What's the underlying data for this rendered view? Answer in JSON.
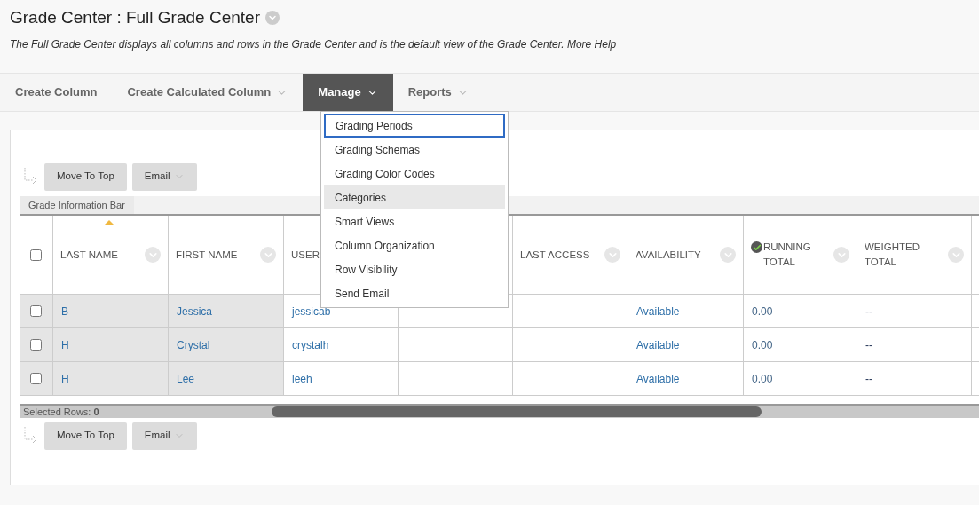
{
  "page": {
    "title": "Grade Center : Full Grade Center",
    "description": "The Full Grade Center displays all columns and rows in the Grade Center and is the default view of the Grade Center.",
    "help_link": "More Help"
  },
  "tabs": [
    {
      "label": "Create Column",
      "has_menu": false,
      "selected": false
    },
    {
      "label": "Create Calculated Column",
      "has_menu": true,
      "selected": false
    },
    {
      "label": "Manage",
      "has_menu": true,
      "selected": true
    },
    {
      "label": "Reports",
      "has_menu": true,
      "selected": false
    }
  ],
  "manage_menu": [
    {
      "label": "Grading Periods",
      "focused": true,
      "highlighted": false
    },
    {
      "label": "Grading Schemas",
      "focused": false,
      "highlighted": false
    },
    {
      "label": "Grading Color Codes",
      "focused": false,
      "highlighted": false
    },
    {
      "label": "Categories",
      "focused": false,
      "highlighted": true
    },
    {
      "label": "Smart Views",
      "focused": false,
      "highlighted": false
    },
    {
      "label": "Column Organization",
      "focused": false,
      "highlighted": false
    },
    {
      "label": "Row Visibility",
      "focused": false,
      "highlighted": false
    },
    {
      "label": "Send Email",
      "focused": false,
      "highlighted": false
    }
  ],
  "top_action_bar": {
    "buttons": [
      {
        "label": "Move To Top",
        "has_menu": false
      },
      {
        "label": "Email",
        "has_menu": true
      }
    ]
  },
  "info_bar": "Grade Information Bar",
  "table": {
    "select_all": {
      "checked": false
    },
    "columns": [
      {
        "label": "LAST NAME",
        "sorted": true,
        "graded": false
      },
      {
        "label": "FIRST NAME",
        "sorted": false,
        "graded": false
      },
      {
        "label": "USER"
      },
      {},
      {
        "label": "LAST ACCESS",
        "sorted": false,
        "graded": false
      },
      {
        "label": "AVAILABILITY",
        "sorted": false,
        "graded": false
      },
      {
        "label": "RUNNING TOTAL",
        "sorted": false,
        "graded": true
      },
      {
        "label": "WEIGHTED TOTAL",
        "sorted": false,
        "graded": false
      }
    ],
    "rows": [
      {
        "checked": false,
        "cells": [
          "B",
          "Jessica",
          "jessicab",
          "",
          "",
          "Available",
          "0.00",
          "--"
        ]
      },
      {
        "checked": false,
        "cells": [
          "H",
          "Crystal",
          "crystalh",
          "",
          "",
          "Available",
          "0.00",
          "--"
        ]
      },
      {
        "checked": false,
        "cells": [
          "H",
          "Lee",
          "leeh",
          "",
          "",
          "Available",
          "0.00",
          "--"
        ]
      }
    ]
  },
  "selection": {
    "label": "Selected Rows:",
    "count": "0"
  },
  "bottom_action_bar": {
    "buttons": [
      {
        "label": "Move To Top",
        "has_menu": false
      },
      {
        "label": "Email",
        "has_menu": true
      }
    ]
  }
}
